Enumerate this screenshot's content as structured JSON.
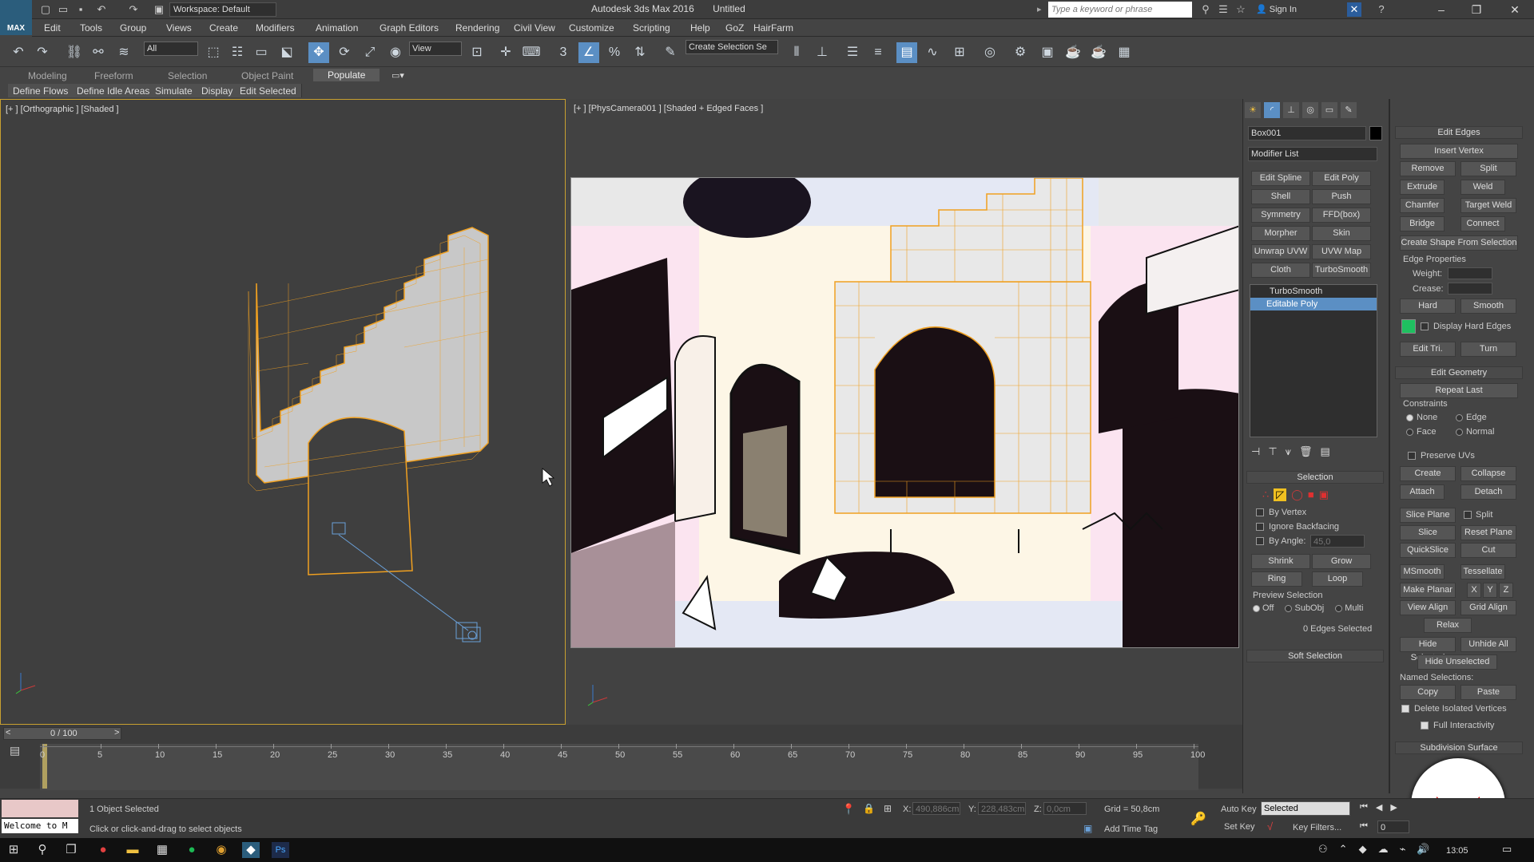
{
  "title_bar": {
    "workspace": "Workspace: Default",
    "app_title": "Autodesk 3ds Max 2016",
    "document": "Untitled",
    "search_placeholder": "Type a keyword or phrase",
    "sign_in": "Sign In"
  },
  "menus": [
    "Edit",
    "Tools",
    "Group",
    "Views",
    "Create",
    "Modifiers",
    "Animation",
    "Graph Editors",
    "Rendering",
    "Civil View",
    "Customize",
    "Scripting",
    "Help",
    "GoZ",
    "HairFarm"
  ],
  "toolbar": {
    "filter": "All",
    "ref_coord": "View",
    "selection_set": "Create Selection Se"
  },
  "ribbon": {
    "tabs": [
      "Modeling",
      "Freeform",
      "Selection",
      "Object Paint",
      "Populate"
    ],
    "active_tab": "Populate",
    "sub_buttons": [
      "Define Flows",
      "Define Idle Areas",
      "Simulate",
      "Display",
      "Edit Selected"
    ]
  },
  "viewports": {
    "left_label": "[+ ] [Orthographic ] [Shaded ]",
    "right_label": "[+ ] [PhysCamera001 ] [Shaded + Edged Faces ]"
  },
  "command_panel": {
    "object_name": "Box001",
    "modifier_list": "Modifier List",
    "modifier_buttons": [
      [
        "Edit Spline",
        "Edit Poly"
      ],
      [
        "Shell",
        "Push"
      ],
      [
        "Symmetry",
        "FFD(box)"
      ],
      [
        "Morpher",
        "Skin"
      ],
      [
        "Unwrap UVW",
        "UVW Map"
      ],
      [
        "Cloth",
        "TurboSmooth"
      ]
    ],
    "stack": [
      "TurboSmooth",
      "Editable Poly"
    ],
    "selection": {
      "header": "Selection",
      "by_vertex": "By Vertex",
      "ignore_backfacing": "Ignore Backfacing",
      "by_angle": "By Angle:",
      "angle_value": "45,0",
      "shrink": "Shrink",
      "grow": "Grow",
      "ring": "Ring",
      "loop": "Loop",
      "preview": "Preview Selection",
      "preview_options": [
        "Off",
        "SubObj",
        "Multi"
      ],
      "status": "0 Edges Selected"
    },
    "soft_selection": "Soft Selection"
  },
  "rollout": {
    "edit_edges": {
      "header": "Edit Edges",
      "insert_vertex": "Insert Vertex",
      "remove": "Remove",
      "split": "Split",
      "extrude": "Extrude",
      "weld": "Weld",
      "chamfer": "Chamfer",
      "target_weld": "Target Weld",
      "bridge": "Bridge",
      "connect": "Connect",
      "create_shape": "Create Shape From Selection",
      "edge_properties": "Edge Properties",
      "weight": "Weight:",
      "crease": "Crease:",
      "hard": "Hard",
      "smooth": "Smooth",
      "display_hard": "Display Hard Edges",
      "edit_tri": "Edit Tri.",
      "turn": "Turn"
    },
    "edit_geometry": {
      "header": "Edit Geometry",
      "repeat_last": "Repeat Last",
      "constraints": "Constraints",
      "constraint_options": [
        "None",
        "Edge",
        "Face",
        "Normal"
      ],
      "preserve_uvs": "Preserve UVs",
      "create": "Create",
      "collapse": "Collapse",
      "attach": "Attach",
      "detach": "Detach",
      "slice_plane": "Slice Plane",
      "split": "Split",
      "slice": "Slice",
      "reset_plane": "Reset Plane",
      "quickslice": "QuickSlice",
      "cut": "Cut",
      "msmooth": "MSmooth",
      "tessellate": "Tessellate",
      "make_planar": "Make Planar",
      "axes": [
        "X",
        "Y",
        "Z"
      ],
      "view_align": "View Align",
      "grid_align": "Grid Align",
      "relax": "Relax",
      "hide_selected": "Hide Selected",
      "unhide_all": "Unhide All",
      "hide_unselected": "Hide Unselected",
      "named_selections": "Named Selections:",
      "copy": "Copy",
      "paste": "Paste",
      "delete_isolated": "Delete Isolated Vertices",
      "full_interactivity": "Full Interactivity"
    },
    "subdivision": "Subdivision Surface"
  },
  "timeline": {
    "frame_counter": "0 / 100",
    "ticks": [
      "0",
      "5",
      "10",
      "15",
      "20",
      "25",
      "30",
      "35",
      "40",
      "45",
      "50",
      "55",
      "60",
      "65",
      "70",
      "75",
      "80",
      "85",
      "90",
      "95",
      "100"
    ]
  },
  "status": {
    "maxscript": "Welcome to M",
    "selected": "1 Object Selected",
    "prompt": "Click or click-and-drag to select objects",
    "x_label": "X:",
    "x_value": "490,886cm",
    "y_label": "Y:",
    "y_value": "228,483cm",
    "z_label": "Z:",
    "z_value": "0,0cm",
    "grid": "Grid = 50,8cm",
    "add_time_tag": "Add Time Tag",
    "auto_key": "Auto Key",
    "set_key": "Set Key",
    "selected_dropdown": "Selected",
    "key_filters": "Key Filters...",
    "frame": "0"
  },
  "taskbar": {
    "time": "13:05"
  },
  "colors": {
    "accent": "#5b8fc4",
    "selection_orange": "#f0a020",
    "viewport_border": "#c8a030"
  }
}
